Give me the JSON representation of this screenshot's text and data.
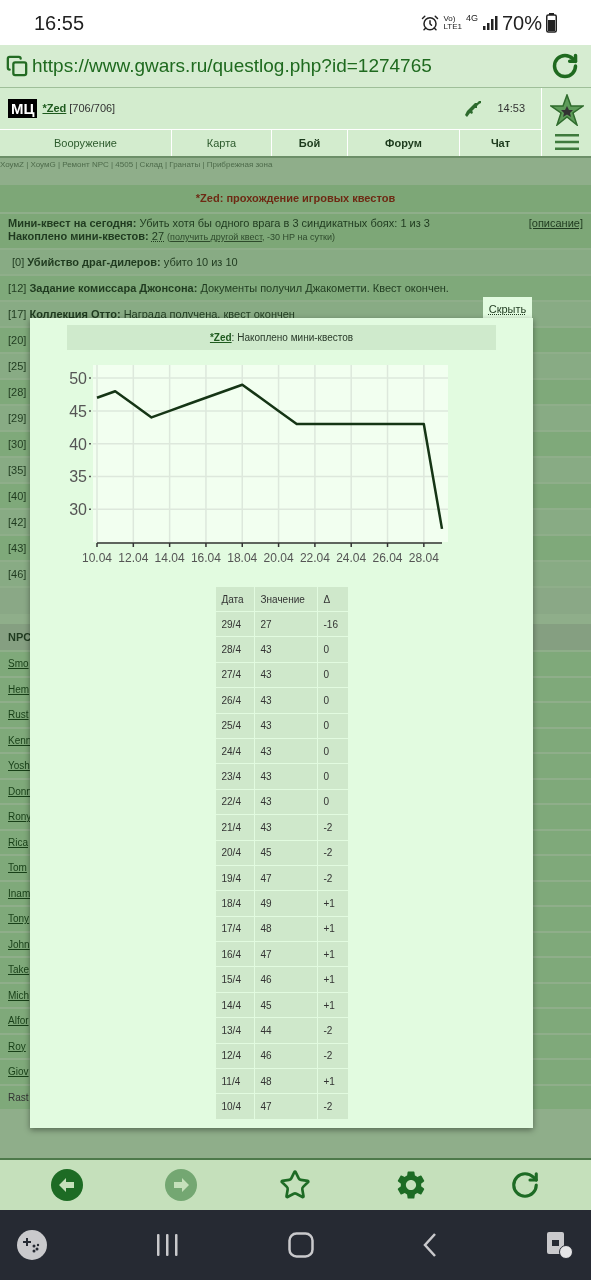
{
  "status_bar": {
    "time": "16:55",
    "network_labels": [
      "Vo)",
      "LTE1",
      "4G"
    ],
    "battery": "70%"
  },
  "address_bar": {
    "url": "https://www.gwars.ru/questlog.php?id=1274765"
  },
  "game_header": {
    "logo": "МЦ",
    "player": "*Zed",
    "hp": "[706/706]",
    "time": "14:53"
  },
  "nav_tabs": [
    {
      "label": "Вооружение",
      "bold": false
    },
    {
      "label": "Карта",
      "bold": false
    },
    {
      "label": "Бой",
      "bold": true
    },
    {
      "label": "Форум",
      "bold": true
    },
    {
      "label": "Чат",
      "bold": true
    }
  ],
  "breadcrumbs": "ХоумZ | ХоумG | Ремонт NPC | 4505 | Склад | Гранаты | Прибрежная зона",
  "quest_log": {
    "title": "*Zed: прохождение игровых квестов",
    "mini_quest": {
      "label": "Мини-квест на сегодня:",
      "text": "Убить хотя бы одного врага в 3 синдикатных боях: 1 из 3",
      "description_link": "[описание]"
    },
    "accumulated": {
      "label": "Накоплено мини-квестов:",
      "count": "27",
      "note_open": "(",
      "link": "получить другой квест",
      "note_rest": ", -30 HP на сутки)"
    },
    "quests": [
      {
        "id": "[0]",
        "name": "Убийство драг-дилеров:",
        "status": "убито 10 из 10"
      },
      {
        "id": "[12]",
        "name": "Задание комиссара Джонсона:",
        "status": "Документы получил Джакометти. Квест окончен."
      },
      {
        "id": "[17]",
        "name": "Коллекция Отто:",
        "status": "Награда получена, квест окончен"
      },
      {
        "id": "[20]"
      },
      {
        "id": "[25]"
      },
      {
        "id": "[28]"
      },
      {
        "id": "[29]"
      },
      {
        "id": "[30]"
      },
      {
        "id": "[35]"
      },
      {
        "id": "[40]"
      },
      {
        "id": "[42]"
      },
      {
        "id": "[43]"
      },
      {
        "id": "[46]"
      }
    ]
  },
  "npc_table": {
    "header": "NPC",
    "rows": [
      {
        "name": "Smo",
        "link": true
      },
      {
        "name": "Hem",
        "link": true
      },
      {
        "name": "Rust",
        "link": true
      },
      {
        "name": "Kenn",
        "link": true
      },
      {
        "name": "Yosh",
        "link": true
      },
      {
        "name": "Donn",
        "link": true
      },
      {
        "name": "Rony",
        "link": true
      },
      {
        "name": "Rica",
        "link": true
      },
      {
        "name": "Tom",
        "link": true
      },
      {
        "name": "Inam",
        "link": true
      },
      {
        "name": "Tony",
        "link": true
      },
      {
        "name": "John",
        "link": true
      },
      {
        "name": "Take",
        "link": true
      },
      {
        "name": "Mich",
        "link": true
      },
      {
        "name": "Alfor",
        "link": true
      },
      {
        "name": "Roy",
        "link": true
      },
      {
        "name": "Giov",
        "link": true
      },
      {
        "name": "Rast",
        "link": false
      }
    ]
  },
  "modal": {
    "hide_button": "Скрыть",
    "title_player": "*Zed",
    "title_text": ": Накоплено мини-квестов",
    "chart_data": {
      "type": "line",
      "categories": [
        "10.04",
        null,
        "12.04",
        null,
        "14.04",
        null,
        "16.04",
        null,
        "18.04",
        null,
        "20.04",
        null,
        "22.04",
        null,
        "24.04",
        null,
        "26.04",
        null,
        "28.04",
        null
      ],
      "values": [
        47,
        48,
        46,
        44,
        45,
        46,
        47,
        48,
        49,
        47,
        45,
        43,
        43,
        43,
        43,
        43,
        43,
        43,
        43,
        27
      ],
      "ylim": [
        25,
        52
      ],
      "grid": true,
      "yticks": [
        30,
        35,
        40,
        45,
        50
      ]
    },
    "table": {
      "columns": [
        "Дата",
        "Значение",
        "Δ"
      ],
      "rows": [
        [
          "29/4",
          "27",
          "-16"
        ],
        [
          "28/4",
          "43",
          "0"
        ],
        [
          "27/4",
          "43",
          "0"
        ],
        [
          "26/4",
          "43",
          "0"
        ],
        [
          "25/4",
          "43",
          "0"
        ],
        [
          "24/4",
          "43",
          "0"
        ],
        [
          "23/4",
          "43",
          "0"
        ],
        [
          "22/4",
          "43",
          "0"
        ],
        [
          "21/4",
          "43",
          "-2"
        ],
        [
          "20/4",
          "45",
          "-2"
        ],
        [
          "19/4",
          "47",
          "-2"
        ],
        [
          "18/4",
          "49",
          "+1"
        ],
        [
          "17/4",
          "48",
          "+1"
        ],
        [
          "16/4",
          "47",
          "+1"
        ],
        [
          "15/4",
          "46",
          "+1"
        ],
        [
          "14/4",
          "45",
          "+1"
        ],
        [
          "13/4",
          "44",
          "-2"
        ],
        [
          "12/4",
          "46",
          "-2"
        ],
        [
          "11/4",
          "48",
          "+1"
        ],
        [
          "10/4",
          "47",
          "-2"
        ]
      ]
    }
  },
  "browser_toolbar": {
    "forward_disabled": true
  }
}
